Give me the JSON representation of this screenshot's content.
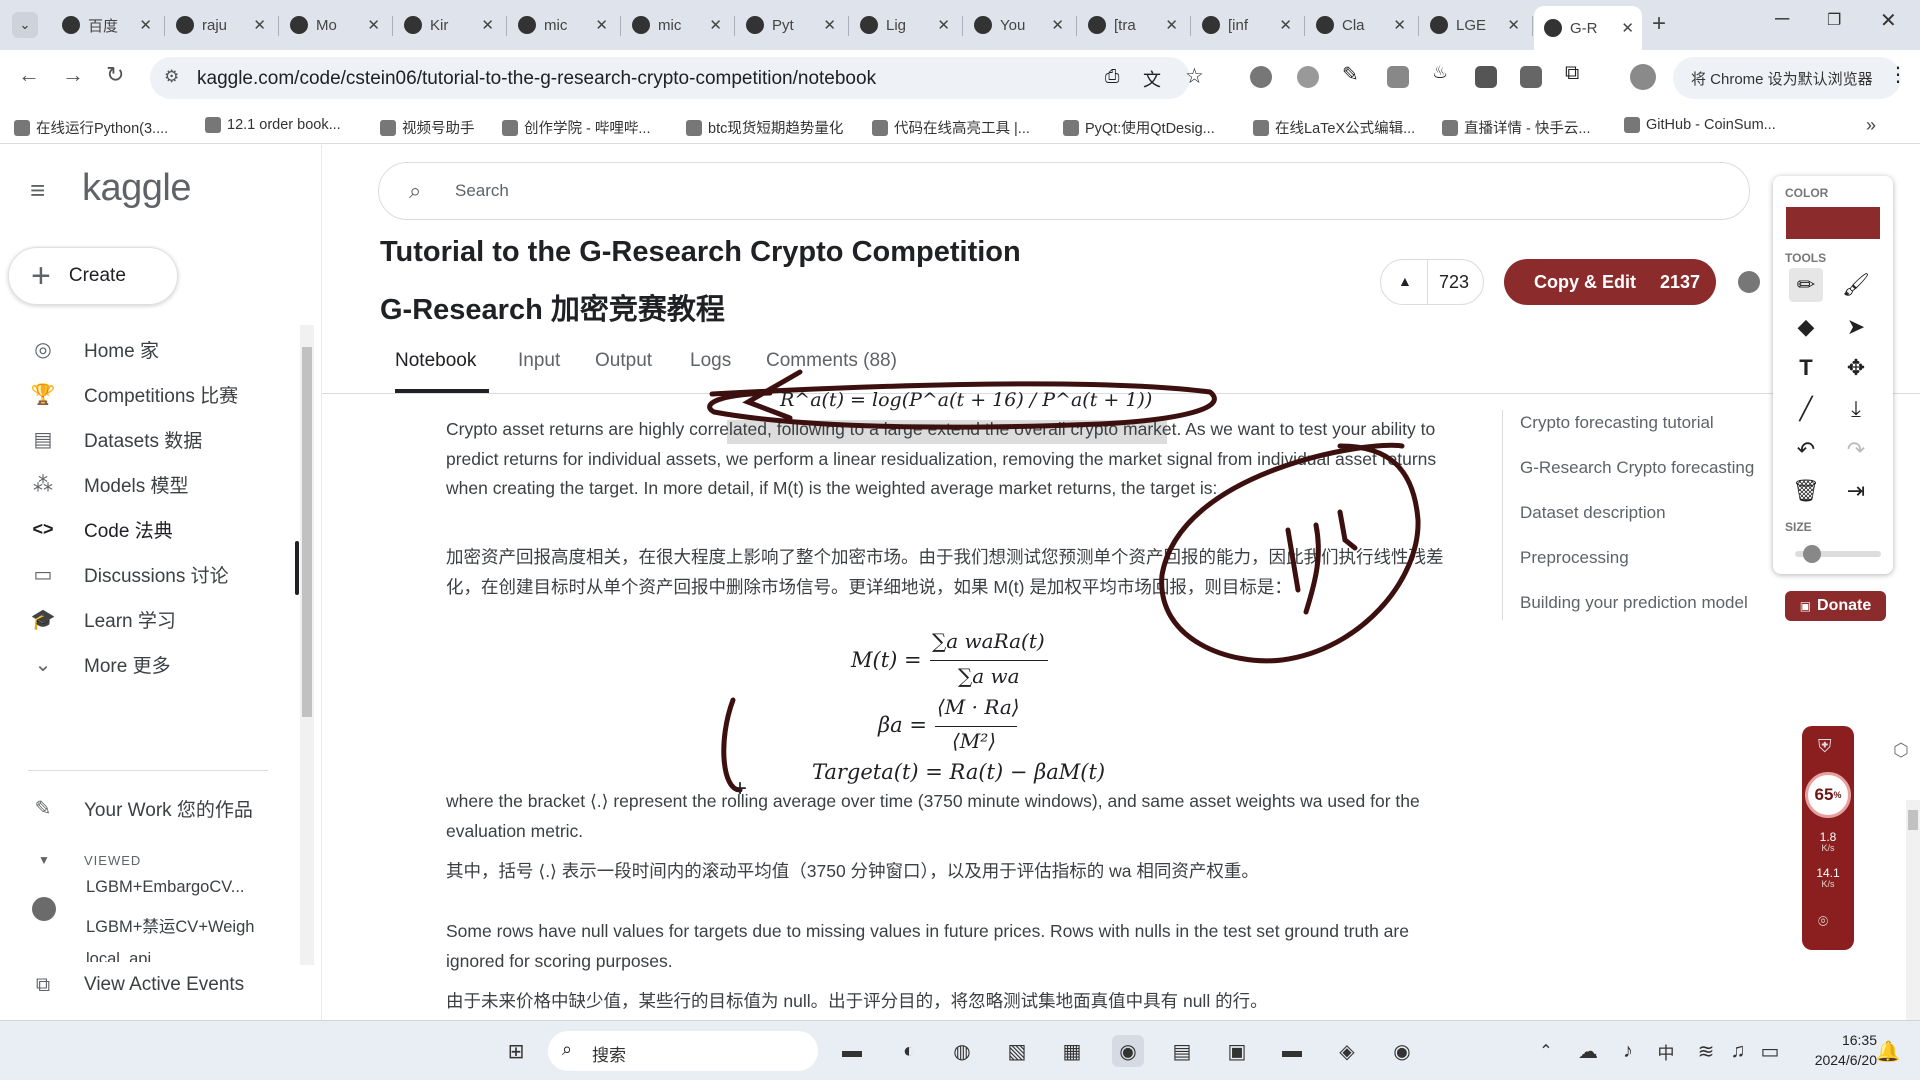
{
  "browser": {
    "tabs": [
      {
        "label": "百度",
        "icon": "grid-icon"
      },
      {
        "label": "raju",
        "icon": "github-icon"
      },
      {
        "label": "Mo",
        "icon": "github-icon"
      },
      {
        "label": "Kir",
        "icon": "k-logo-icon"
      },
      {
        "label": "mic",
        "icon": "github-icon"
      },
      {
        "label": "mic",
        "icon": "github-icon"
      },
      {
        "label": "Pyt",
        "icon": "doc-icon"
      },
      {
        "label": "Lig",
        "icon": "github-icon"
      },
      {
        "label": "You",
        "icon": "kaggle-icon"
      },
      {
        "label": "[tra",
        "icon": "kaggle-icon"
      },
      {
        "label": "[inf",
        "icon": "kaggle-icon"
      },
      {
        "label": "Cla",
        "icon": "spark-icon"
      },
      {
        "label": "LGE",
        "icon": "kaggle-icon"
      },
      {
        "label": "G-R",
        "icon": "kaggle-icon"
      }
    ],
    "url": "kaggle.com/code/cstein06/tutorial-to-the-g-research-crypto-competition/notebook",
    "default_browser_btn": "将 Chrome 设为默认浏览器",
    "bookmarks": [
      "在线运行Python(3....",
      "12.1 order book...",
      "视频号助手",
      "创作学院 - 哔哩哔...",
      "btc现货短期趋势量化",
      "代码在线高亮工具 |...",
      "PyQt:使用QtDesig...",
      "在线LaTeX公式编辑...",
      "直播详情 - 快手云...",
      "GitHub - CoinSum..."
    ]
  },
  "sidebar": {
    "logo": "kaggle",
    "create": "Create",
    "items": [
      "Home 家",
      "Competitions 比赛",
      "Datasets 数据",
      "Models 模型",
      "Code 法典",
      "Discussions 讨论",
      "Learn 学习",
      "More 更多"
    ],
    "your_work": "Your Work 您的作品",
    "viewed_label": "VIEWED",
    "viewed": [
      "LGBM+EmbargoCV...",
      "LGBM+禁运CV+Weigh",
      "local_api"
    ],
    "active_events": "View Active Events"
  },
  "search": {
    "placeholder": "Search"
  },
  "notebook": {
    "title": "Tutorial to the G-Research Crypto Competition",
    "title_cn": "G-Research 加密竞赛教程",
    "votes": "723",
    "copy_edit": "Copy & Edit",
    "copy_count": "2137",
    "tabs": [
      "Notebook",
      "Input",
      "Output",
      "Logs",
      "Comments (88)"
    ],
    "formula_top": "R^a(t) = log(P^a(t + 16) / P^a(t + 1))",
    "p1": "Crypto asset returns are highly correlated, following to a large extend the overall crypto market. As we want to test your ability to predict returns for individual assets, we perform a linear residualization, removing the market signal from individual asset returns when creating the target. In more detail, if M(t) is the weighted average market returns, the target is:",
    "p1_cn": "加密资产回报高度相关，在很大程度上影响了整个加密市场。由于我们想测试您预测单个资产回报的能力，因此我们执行线性残差化，在创建目标时从单个资产回报中删除市场信号。更详细地说，如果 M(t) 是加权平均市场回报，则目标是：",
    "eq1_lhs": "M(t) =",
    "eq1_num": "∑a waRa(t)",
    "eq1_den": "∑a wa",
    "eq2_lhs": "βa =",
    "eq2_num": "⟨M · Ra⟩",
    "eq2_den": "⟨M²⟩",
    "eq3": "Targeta(t) = Ra(t) − βaM(t)",
    "p2": "where the bracket ⟨.⟩ represent the rolling average over time (3750 minute windows), and same asset weights wa used for the evaluation metric.",
    "p2_cn": "其中，括号 ⟨.⟩ 表示一段时间内的滚动平均值（3750 分钟窗口），以及用于评估指标的 wa 相同资产权重。",
    "p3": "Some rows have null values for targets due to missing values in future prices. Rows with nulls in the test set ground truth are ignored for scoring purposes.",
    "p3_cn": "由于未来价格中缺少值，某些行的目标值为 null。出于评分目的，将忽略测试集地面真值中具有 null 的行。"
  },
  "toc": [
    "Crypto forecasting tutorial",
    "G-Research Crypto forecasting",
    "Dataset description",
    "Preprocessing",
    "Building your prediction model"
  ],
  "donate": "Donate",
  "palette": {
    "color_label": "COLOR",
    "tools_label": "TOOLS",
    "size_label": "SIZE",
    "color": "#8b2b2b",
    "size_level": 0.2
  },
  "netmon": {
    "percent": "65",
    "unit": "%",
    "up": "1.8",
    "down": "14.1",
    "rate_unit": "K/s"
  },
  "taskbar": {
    "search": "搜索",
    "ime": "中",
    "time": "16:35",
    "date": "2024/6/20"
  },
  "colors": {
    "kaggle_btn": "#8b2b2b",
    "ink": "#3d1010",
    "accent": "#20beff"
  }
}
